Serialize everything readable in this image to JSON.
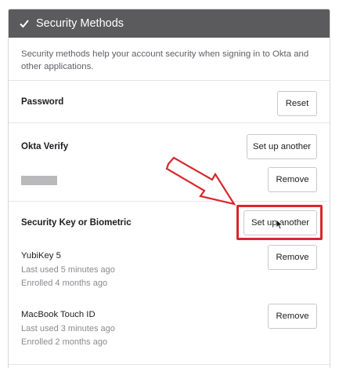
{
  "header": {
    "title": "Security Methods"
  },
  "description": "Security methods help your account security when signing in to Okta and other applications.",
  "password": {
    "label": "Password",
    "reset_label": "Reset"
  },
  "okta_verify": {
    "label": "Okta Verify",
    "setup_label": "Set up another",
    "remove_label": "Remove"
  },
  "security_key": {
    "label": "Security Key or Biometric",
    "setup_label": "Set up another",
    "devices": [
      {
        "name": "YubiKey 5",
        "last_used": "Last used 5 minutes ago",
        "enrolled": "Enrolled 4 months ago",
        "remove_label": "Remove"
      },
      {
        "name": "MacBook Touch ID",
        "last_used": "Last used 3 minutes ago",
        "enrolled": "Enrolled 2 months ago",
        "remove_label": "Remove"
      }
    ]
  },
  "colors": {
    "header_bg": "#5b5b5e",
    "annotation_red": "#d8272d"
  },
  "icons": {
    "header": "check-icon",
    "annotation": "red-arrow-icon",
    "pointer": "cursor-icon"
  }
}
